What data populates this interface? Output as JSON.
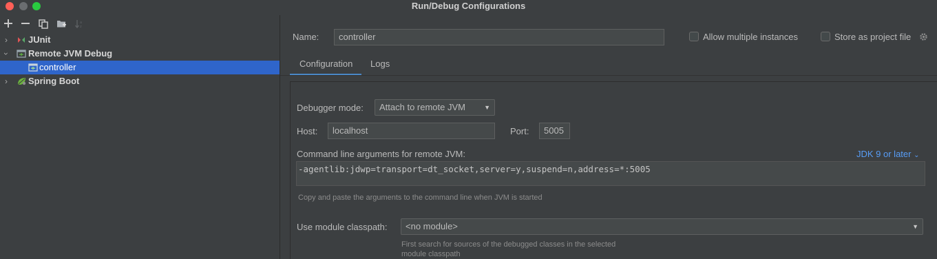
{
  "window": {
    "title": "Run/Debug Configurations"
  },
  "toolbar": {
    "add_icon": "plus-icon",
    "remove_icon": "minus-icon",
    "copy_icon": "copy-icon",
    "folder_icon": "new-folder-icon",
    "sort_icon": "sort-icon"
  },
  "tree": {
    "items": [
      {
        "label": "JUnit",
        "icon": "junit-icon",
        "expanded": false,
        "level": 0
      },
      {
        "label": "Remote JVM Debug",
        "icon": "remote-debug-icon",
        "expanded": true,
        "level": 0
      },
      {
        "label": "controller",
        "icon": "remote-config-icon",
        "level": 1,
        "selected": true
      },
      {
        "label": "Spring Boot",
        "icon": "spring-boot-icon",
        "expanded": false,
        "level": 0
      }
    ]
  },
  "form": {
    "name_label": "Name:",
    "name_value": "controller",
    "allow_multiple_label": "Allow multiple instances",
    "store_as_file_label": "Store as project file"
  },
  "tabs": [
    {
      "label": "Configuration",
      "active": true
    },
    {
      "label": "Logs",
      "active": false
    }
  ],
  "config": {
    "debugger_mode_label": "Debugger mode:",
    "debugger_mode_value": "Attach to remote JVM",
    "host_label": "Host:",
    "host_value": "localhost",
    "port_label": "Port:",
    "port_value": "5005",
    "cmdline_label": "Command line arguments for remote JVM:",
    "jdk_link": "JDK 9 or later",
    "cmdline_value": "-agentlib:jdwp=transport=dt_socket,server=y,suspend=n,address=*:5005",
    "cmdline_hint": "Copy and paste the arguments to the command line when JVM is started",
    "module_label": "Use module classpath:",
    "module_value": "<no module>",
    "module_hint_line1": "First search for sources of the debugged classes in the selected",
    "module_hint_line2": "module classpath"
  },
  "colors": {
    "background": "#3c3f41",
    "selection": "#2f65ca",
    "link": "#589df6",
    "tab_underline": "#4a88c7"
  }
}
